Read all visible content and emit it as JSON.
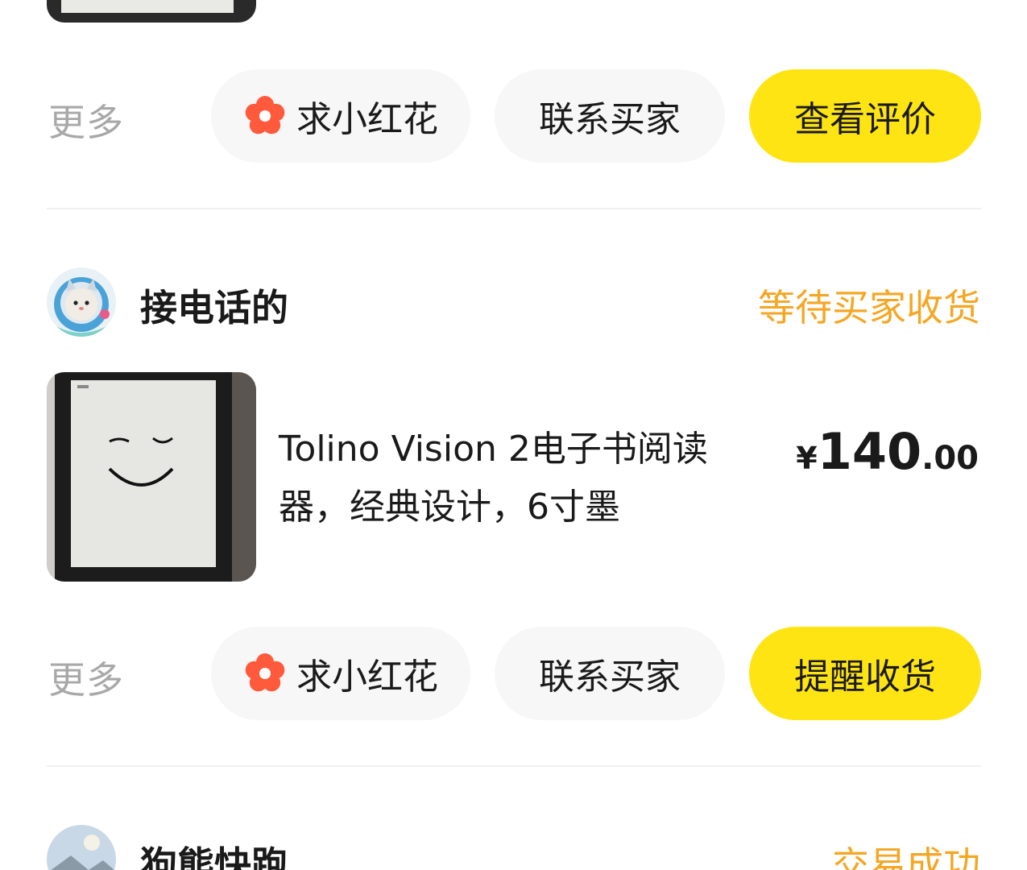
{
  "order_1": {
    "more_label": "更多",
    "flower_button_label": "求小红花",
    "contact_button_label": "联系买家",
    "primary_button_label": "查看评价"
  },
  "order_2": {
    "seller_name": "接电话的",
    "status": "等待买家收货",
    "product_title": "Tolino Vision 2电子书阅读器，经典设计，6寸墨",
    "price": {
      "currency": "¥",
      "integer": "140",
      "decimal": ".00"
    },
    "more_label": "更多",
    "flower_button_label": "求小红花",
    "contact_button_label": "联系买家",
    "primary_button_label": "提醒收货"
  },
  "order_3": {
    "seller_name": "狗熊快跑",
    "status": "交易成功"
  },
  "colors": {
    "accent_yellow": "#ffe414",
    "status_orange": "#f5a623",
    "flower_red": "#ff5a3c",
    "muted_text": "#a8a8a8"
  },
  "icons": {
    "flower": "flower-icon"
  }
}
